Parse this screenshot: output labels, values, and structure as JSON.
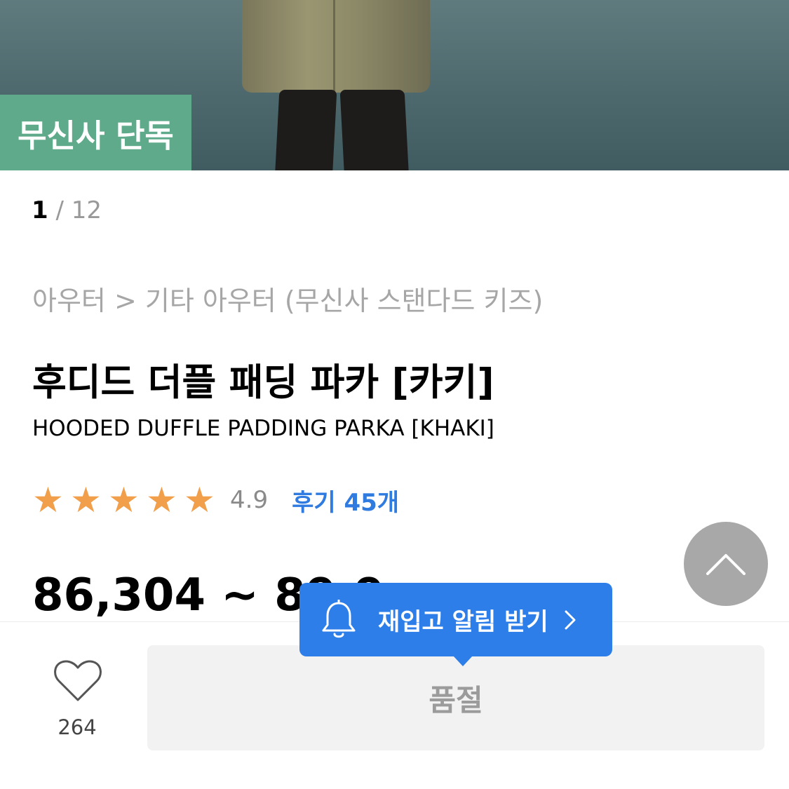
{
  "hero": {
    "badge": "무신사 단독"
  },
  "pager": {
    "current": "1",
    "separator": " / ",
    "total": "12"
  },
  "product": {
    "category": "아우터 > 기타 아우터 (무신사 스탠다드 키즈)",
    "title_ko": "후디드 더플 패딩 파카 [카키]",
    "title_en": "HOODED DUFFLE PADDING PARKA [KHAKI]",
    "rating": {
      "stars": 5,
      "star_glyph": "★",
      "score": "4.9",
      "reviews_label": "후기 45개"
    },
    "price": "86,304 ~ 89,9"
  },
  "bottom": {
    "like_count": "264",
    "soldout_label": "품절",
    "restock_label": "재입고 알림 받기"
  },
  "colors": {
    "badge": "#5faa8a",
    "star": "#f29f4b",
    "link": "#2f7be0",
    "tooltip": "#2d7ee8"
  },
  "icons": [
    "chevron-up-icon",
    "heart-icon",
    "bell-icon",
    "chevron-right-icon"
  ]
}
